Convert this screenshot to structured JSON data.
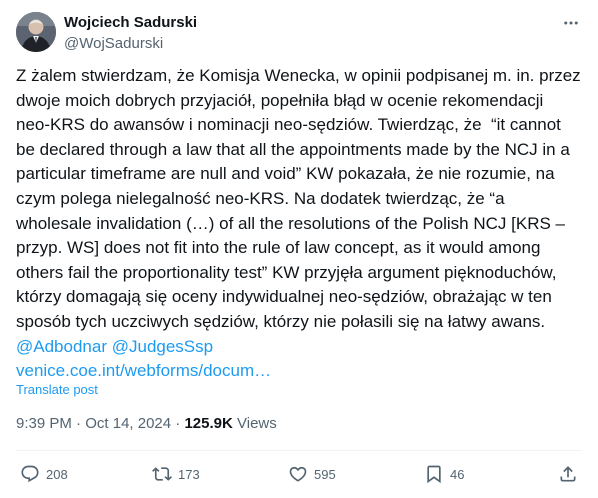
{
  "author": {
    "name": "Wojciech Sadurski",
    "handle": "@WojSadurski"
  },
  "post": {
    "text": "Z żalem stwierdzam, że Komisja Wenecka, w opinii podpisanej m. in. przez dwoje moich dobrych przyjaciół, popełniła błąd w ocenie rekomendacji neo-KRS do awansów i nominacji neo-sędziów. Twierdząc, że  “it cannot be declared through a law that all the appointments made by the NCJ in a particular timeframe are null and void” KW pokazała, że nie rozumie, na czym polega nielegalność neo-KRS. Na dodatek twierdząc, że “a wholesale invalidation (…) of all the resolutions of the Polish NCJ [KRS – przyp. WS] does not fit into the rule of law concept, as it would among others fail the proportionality test” KW przyjęła argument pięknoduchów, którzy domagają się oceny indywidualnej neo-sędziów, obrażając w ten sposób tych uczciwych sędziów, którzy nie połasili się na łatwy awans. ",
    "mention1": "@Adbodnar",
    "mention2": "@JudgesSsp",
    "link": "venice.coe.int/webforms/docum…",
    "translate": "Translate post"
  },
  "meta": {
    "time": "9:39 PM",
    "separator": "·",
    "date": "Oct 14, 2024",
    "views_count": "125.9K",
    "views_label": "Views"
  },
  "actions": {
    "replies": "208",
    "reposts": "173",
    "likes": "595",
    "bookmarks": "46"
  },
  "colors": {
    "accent": "#1d9bf0",
    "text": "#0f1419",
    "secondary": "#536471",
    "divider": "#eff3f4"
  }
}
